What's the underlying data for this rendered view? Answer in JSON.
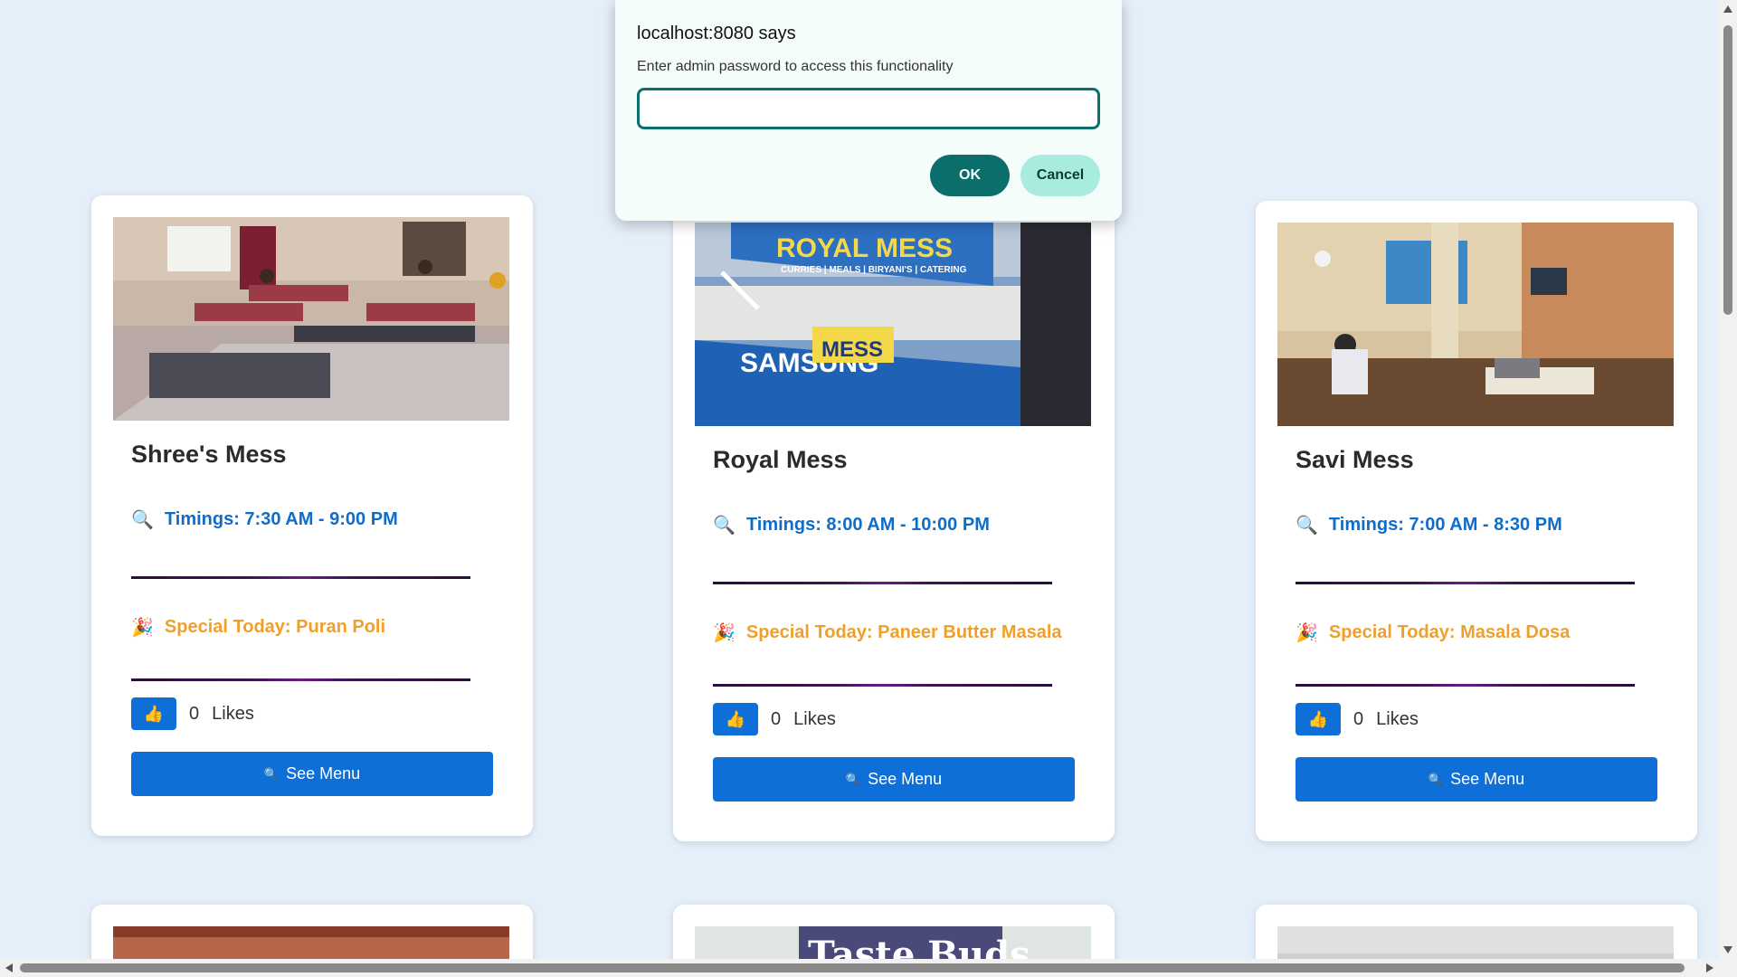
{
  "dialog": {
    "title": "localhost:8080 says",
    "message": "Enter admin password to access this functionality",
    "input_value": "",
    "ok_label": "OK",
    "cancel_label": "Cancel"
  },
  "cards": [
    {
      "name": "Shree's Mess",
      "timings_icon": "🔍",
      "timings": "Timings: 7:30 AM - 9:00 PM",
      "special_icon": "🎉",
      "special": "Special Today: Puran Poli",
      "like_icon": "👍",
      "likes_count": "0",
      "likes_label": "Likes",
      "menu_icon": "🔍",
      "menu_label": "See Menu"
    },
    {
      "name": "Royal Mess",
      "photo_sign_main": "ROYAL MESS",
      "photo_sign_sub": "CURRIES | MEALS | BIRYANI'S | CATERING",
      "photo_sign_brand": "SAMSUNG",
      "photo_sign_mess": "MESS",
      "timings_icon": "🔍",
      "timings": "Timings: 8:00 AM - 10:00 PM",
      "special_icon": "🎉",
      "special": "Special Today: Paneer Butter Masala",
      "like_icon": "👍",
      "likes_count": "0",
      "likes_label": "Likes",
      "menu_icon": "🔍",
      "menu_label": "See Menu"
    },
    {
      "name": "Savi Mess",
      "timings_icon": "🔍",
      "timings": "Timings: 7:00 AM - 8:30 PM",
      "special_icon": "🎉",
      "special": "Special Today: Masala Dosa",
      "like_icon": "👍",
      "likes_count": "0",
      "likes_label": "Likes",
      "menu_icon": "🔍",
      "menu_label": "See Menu"
    }
  ],
  "bottom_cards": [
    {
      "photo_text": ""
    },
    {
      "photo_text": "Taste Buds"
    },
    {
      "photo_text": ""
    }
  ],
  "colors": {
    "page_bg": "#e4effa",
    "accent_blue": "#0f6fd8",
    "timings_blue": "#0f6dc9",
    "special_orange": "#f0a02a",
    "dialog_teal": "#0c6e6a"
  }
}
